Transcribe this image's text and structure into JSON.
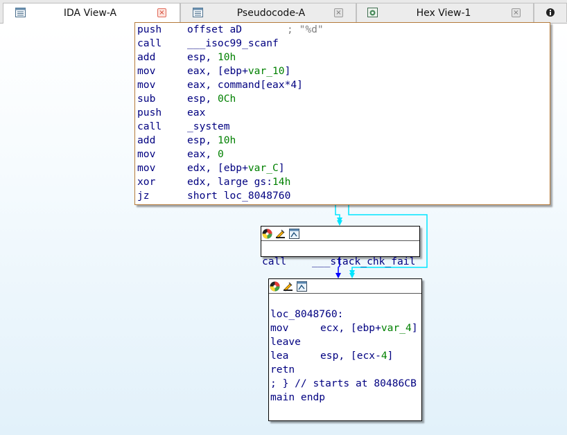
{
  "tabs": [
    {
      "label": "IDA View-A",
      "icon": "text-view-icon",
      "active": true
    },
    {
      "label": "Pseudocode-A",
      "icon": "text-view-icon",
      "active": false
    },
    {
      "label": "Hex View-1",
      "icon": "hex-view-icon",
      "active": false
    }
  ],
  "tab_close_glyph": "×",
  "overflow_icon": "info-icon",
  "main_block": {
    "lines": [
      {
        "m": "push",
        "o": "offset aD",
        "c": "; \"%d\""
      },
      {
        "m": "call",
        "o": "___isoc99_scanf"
      },
      {
        "m": "add",
        "o": "esp, ",
        "n": "10h"
      },
      {
        "m": "mov",
        "o": "eax, [ebp+",
        "v": "var_10",
        "e": "]"
      },
      {
        "m": "mov",
        "o": "eax, command[eax*4]"
      },
      {
        "m": "sub",
        "o": "esp, ",
        "n": "0Ch"
      },
      {
        "m": "push",
        "o": "eax"
      },
      {
        "m": "call",
        "o": "_system"
      },
      {
        "m": "add",
        "o": "esp, ",
        "n": "10h"
      },
      {
        "m": "mov",
        "o": "eax, ",
        "n": "0"
      },
      {
        "m": "mov",
        "o": "edx, [ebp+",
        "v": "var_C",
        "e": "]"
      },
      {
        "m": "xor",
        "o": "edx, large gs:",
        "n": "14h"
      },
      {
        "m": "jz",
        "o": "short loc_8048760"
      }
    ]
  },
  "fail_block": {
    "m": "call",
    "o": "___stack_chk_fail"
  },
  "end_block": {
    "label": "loc_8048760:",
    "lines": [
      {
        "m": "mov",
        "o": "ecx, [ebp+",
        "v": "var_4",
        "e": "]"
      },
      {
        "m": "leave",
        "o": ""
      },
      {
        "m": "lea",
        "o": "esp, [ecx-",
        "n": "4",
        "e": "]"
      },
      {
        "m": "retn",
        "o": ""
      }
    ],
    "comment": "; } // starts at 80486CB",
    "endp": "main endp"
  },
  "node_header_icons": [
    "color-palette-icon",
    "rename-icon",
    "graph-icon"
  ],
  "colors": {
    "edge_true": "#00e5ff",
    "edge_false": "#0000ff",
    "mnemonic": "#000080",
    "number": "#008000",
    "comment": "#808080"
  }
}
